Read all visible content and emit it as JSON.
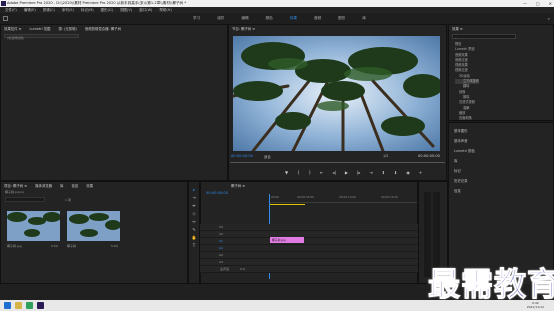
{
  "window": {
    "title": "Adobe Premiere Pro 2020 - D:\\\\2020\\\\素材 Premiere Pro 2020 从新手到高手(多)\\\\第1-2章\\\\素材\\\\椰子树 *",
    "controls": [
      "—",
      "□",
      "✕"
    ]
  },
  "menu": [
    "文件(F)",
    "编辑(E)",
    "剪辑(C)",
    "序列(S)",
    "标记(M)",
    "图形(G)",
    "视图(V)",
    "窗口(W)",
    "帮助(H)"
  ],
  "workspaces": {
    "items": [
      "学习",
      "组件",
      "编辑",
      "颜色",
      "效果",
      "音频",
      "图形",
      "库"
    ],
    "active_index": 4
  },
  "source_panel": {
    "tabs": [
      "效果控件 ≡",
      "Lumetri 范围",
      "源: (无剪辑)",
      "音频剪辑混合器: 椰子树"
    ],
    "subtitle": "(未选择剪辑)"
  },
  "program_monitor": {
    "tab": "节目: 椰子树 ≡",
    "timecode_left": "00:00:00:00",
    "fit_label": "适合",
    "quality": "1/2",
    "timecode_right": "00:00:05:00"
  },
  "project_panel": {
    "tabs": [
      "项目: 椰子树 ≡",
      "媒体浏览器",
      "库",
      "信息",
      "效果"
    ],
    "project_file": "椰子树.prproj",
    "item_count": "1 项",
    "items": [
      {
        "name": "椰子树.jpg",
        "duration": "5:00"
      },
      {
        "name": "椰子树",
        "duration": "5:00"
      }
    ]
  },
  "timeline": {
    "tab": "椰子树 ≡",
    "timecode": "00:00:00:00",
    "ruler": [
      "00:00",
      "00:00:05:00",
      "00:00:10:00",
      "00:00:15:00"
    ],
    "video_tracks": [
      "V3",
      "V2",
      "V1"
    ],
    "audio_tracks": [
      "A1",
      "A2",
      "A3"
    ],
    "master_label": "主声道",
    "master_value": "0.0",
    "clip_label": "椰子树.jpg"
  },
  "effects_panel": {
    "tab": "效果 ≡",
    "items": [
      "预设",
      "Lumetri 预设",
      "音频效果",
      "音频过渡",
      "视频效果",
      "视频过渡",
      "3D运动",
      "立方体旋转",
      "翻转",
      "划像",
      "擦除",
      "沉浸式视频",
      "溶解",
      "缩放",
      "页面剥落"
    ]
  },
  "effects_lower": [
    "基本图形",
    "基本声音",
    "Lumetri 颜色",
    "库",
    "标记",
    "历史记录",
    "信息"
  ],
  "taskbar": {
    "time": "9:40",
    "date": "2021/11/12"
  },
  "watermark": "最需教育"
}
